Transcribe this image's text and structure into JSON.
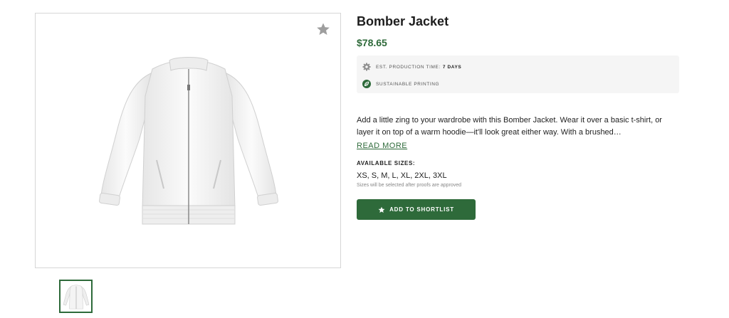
{
  "product": {
    "title": "Bomber Jacket",
    "price": "$78.65",
    "image_icon": "jacket-image",
    "favorite_icon": "star-icon"
  },
  "info": {
    "production_label": "EST. PRODUCTION TIME:",
    "production_value": "7 DAYS",
    "production_icon": "gear-icon",
    "sustainable_label": "SUSTAINABLE PRINTING",
    "sustainable_icon": "leaf-icon"
  },
  "description": {
    "text": "Add a little zing to your wardrobe with this Bomber Jacket. Wear it over a basic t-shirt, or layer it on top of a warm hoodie—it'll look great either way. With a brushed…",
    "read_more": "READ MORE"
  },
  "sizes": {
    "heading": "AVAILABLE SIZES:",
    "list": "XS, S, M, L, XL, 2XL, 3XL",
    "note": "Sizes will be selected after proofs are approved"
  },
  "actions": {
    "shortlist_label": "ADD TO SHORTLIST",
    "shortlist_icon": "star-icon"
  },
  "colors": {
    "accent": "#2e6a3a",
    "info_bg": "#f5f5f5",
    "border": "#d6d6d6"
  }
}
